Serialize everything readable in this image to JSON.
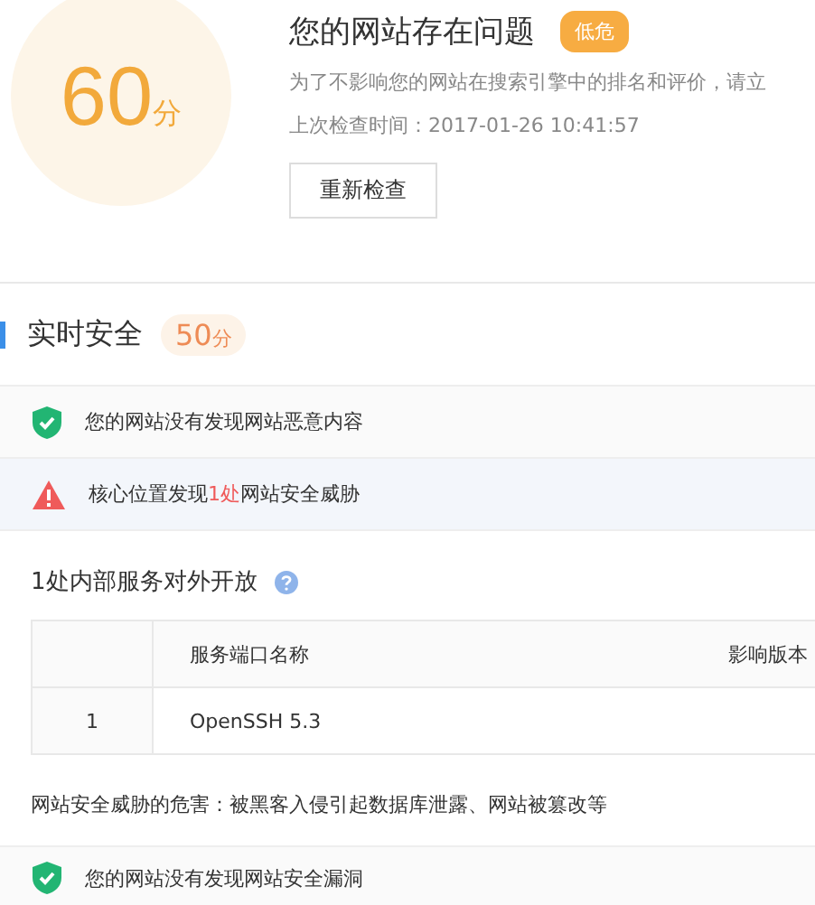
{
  "summary": {
    "score": "60",
    "unit": "分",
    "title": "您的网站存在问题",
    "risk_badge": "低危",
    "description": "为了不影响您的网站在搜索引擎中的排名和评价，请立",
    "last_check": "上次检查时间：2017-01-26 10:41:57",
    "recheck_button": "重新检查"
  },
  "section": {
    "title": "实时安全",
    "score": "50",
    "unit": "分"
  },
  "checks": [
    {
      "kind": "ok",
      "parts": [
        {
          "text": "您的网站没有发现网站恶意内容",
          "highlight": false
        }
      ]
    },
    {
      "kind": "warning",
      "parts": [
        {
          "text": "核心位置发现",
          "highlight": false
        },
        {
          "text": "1处",
          "highlight": true
        },
        {
          "text": "网站安全威胁",
          "highlight": false
        }
      ]
    }
  ],
  "services": {
    "title": "1处内部服务对外开放",
    "columns": [
      "服务端口名称",
      "影响版本"
    ],
    "rows": [
      {
        "index": "1",
        "name": "OpenSSH 5.3"
      }
    ],
    "note": "网站安全威胁的危害：被黑客入侵引起数据库泄露、网站被篡改等"
  },
  "footer_check": {
    "kind": "ok",
    "text": "您的网站没有发现网站安全漏洞"
  }
}
